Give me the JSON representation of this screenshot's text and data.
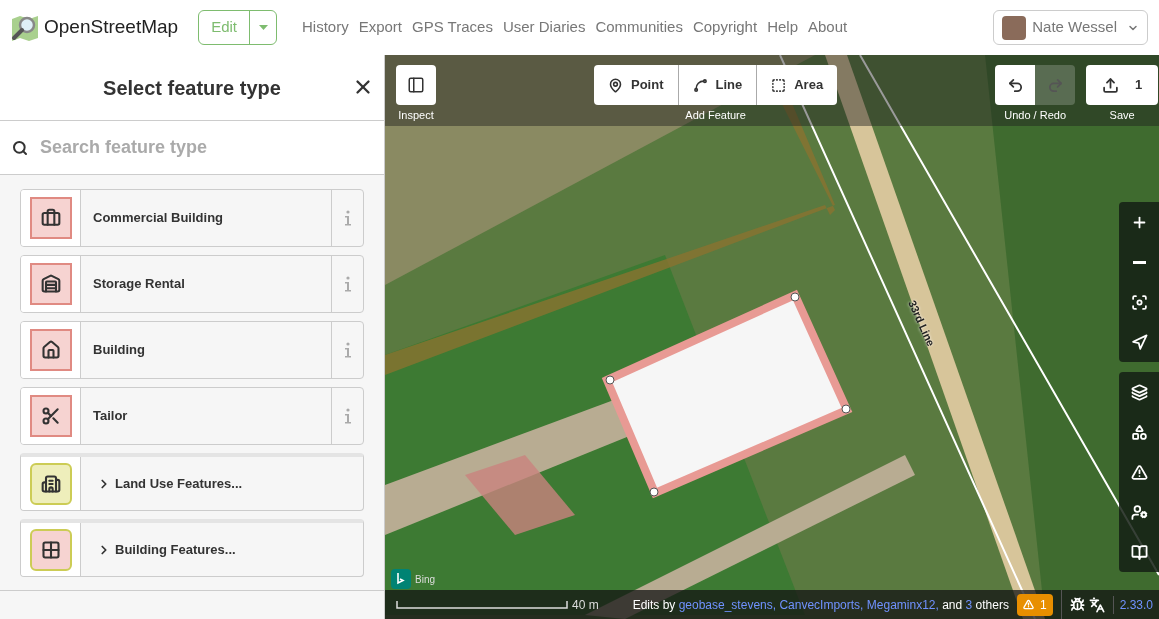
{
  "header": {
    "logo": "OpenStreetMap",
    "edit_button": "Edit",
    "nav": [
      "History",
      "Export",
      "GPS Traces",
      "User Diaries",
      "Communities",
      "Copyright",
      "Help",
      "About"
    ],
    "user": "Nate Wessel"
  },
  "sidebar": {
    "title": "Select feature type",
    "search": {
      "placeholder": "Search feature type"
    },
    "items": [
      {
        "kind": "preset",
        "label": "Commercial Building",
        "color": "#f6d3d1"
      },
      {
        "kind": "preset",
        "label": "Storage Rental",
        "color": "#f6d3d1"
      },
      {
        "kind": "preset",
        "label": "Building",
        "color": "#f6d3d1"
      },
      {
        "kind": "preset",
        "label": "Tailor",
        "color": "#f6d3d1"
      },
      {
        "kind": "category",
        "label": "Land Use Features...",
        "color": "#eeeebb"
      },
      {
        "kind": "category",
        "label": "Building Features...",
        "color": "#f6d3d1"
      }
    ]
  },
  "map": {
    "toolbar": {
      "inspect": "Inspect",
      "add_modes": [
        {
          "label": "Point"
        },
        {
          "label": "Line"
        },
        {
          "label": "Area"
        }
      ],
      "add_caption": "Add Feature",
      "undo": {
        "disabled": false
      },
      "redo": {
        "disabled": true
      },
      "undo_caption": "Undo / Redo",
      "save_count": "1",
      "save_caption": "Save"
    },
    "road_label": "33rd Line",
    "imagery": "Bing",
    "footer": {
      "scale": "40 m",
      "credits_prefix": "Edits by",
      "credits_links": [
        "geobase_stevens,",
        "CanvecImports,",
        "Megaminx12,"
      ],
      "credits_and": "and",
      "credits_count": "3",
      "credits_suffix": "others",
      "issues": "1",
      "version": "2.33.0"
    }
  }
}
